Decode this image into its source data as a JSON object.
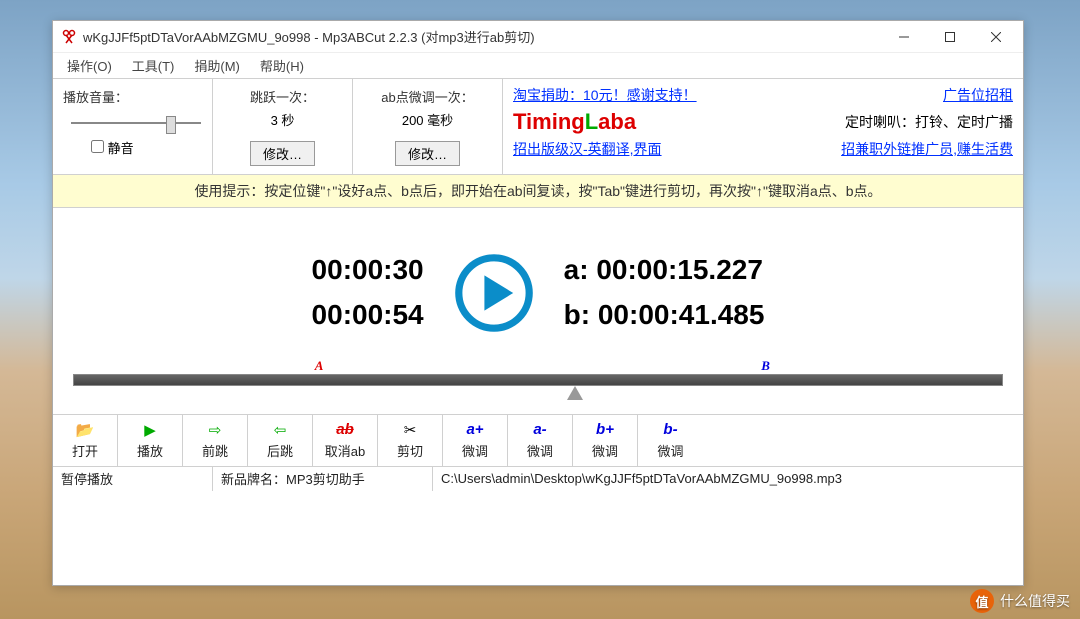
{
  "window": {
    "title": "wKgJJFf5ptDTaVorAAbMZGMU_9o998 - Mp3ABCut 2.2.3   (对mp3进行ab剪切)"
  },
  "menu": {
    "operate": "操作(O)",
    "tools": "工具(T)",
    "donate": "捐助(M)",
    "help": "帮助(H)"
  },
  "panels": {
    "volume_label": "播放音量：",
    "mute": "静音",
    "jump_label": "跳跃一次：",
    "jump_value": "3 秒",
    "fine_label": "ab点微调一次：",
    "fine_value": "200 毫秒",
    "modify": "修改…"
  },
  "ads": {
    "line1_left": "淘宝捐助：10元！感谢支持！",
    "line1_right": "广告位招租",
    "brand_prefix": "Timing",
    "brand_l": "L",
    "brand_suffix": "aba",
    "line2_right": "定时喇叭：打铃、定时广播",
    "line3_left": "招出版级汉-英翻译,界面",
    "line3_right": "招兼职外链推广员,赚生活费"
  },
  "hint": "使用提示：按定位键\"↑\"设好a点、b点后，即开始在ab间复读，按\"Tab\"键进行剪切，再次按\"↑\"键取消a点、b点。",
  "times": {
    "current": "00:00:30",
    "total": "00:00:54",
    "a_label": "a:",
    "a_value": "00:00:15.227",
    "b_label": "b:",
    "b_value": "00:00:41.485"
  },
  "markers": {
    "a": "A",
    "b": "B"
  },
  "toolbar": {
    "open": "打开",
    "play": "播放",
    "fwd": "前跳",
    "back": "后跳",
    "cancel_ab": "取消ab",
    "cut": "剪切",
    "a_plus": "微调",
    "a_minus": "微调",
    "b_plus": "微调",
    "b_minus": "微调",
    "icon_ab": "ab",
    "icon_ap": "a+",
    "icon_am": "a-",
    "icon_bp": "b+",
    "icon_bm": "b-"
  },
  "status": {
    "state": "暂停播放",
    "brand": "新品牌名：MP3剪切助手",
    "path": "C:\\Users\\admin\\Desktop\\wKgJJFf5ptDTaVorAAbMZGMU_9o998.mp3"
  },
  "watermark": "什么值得买"
}
